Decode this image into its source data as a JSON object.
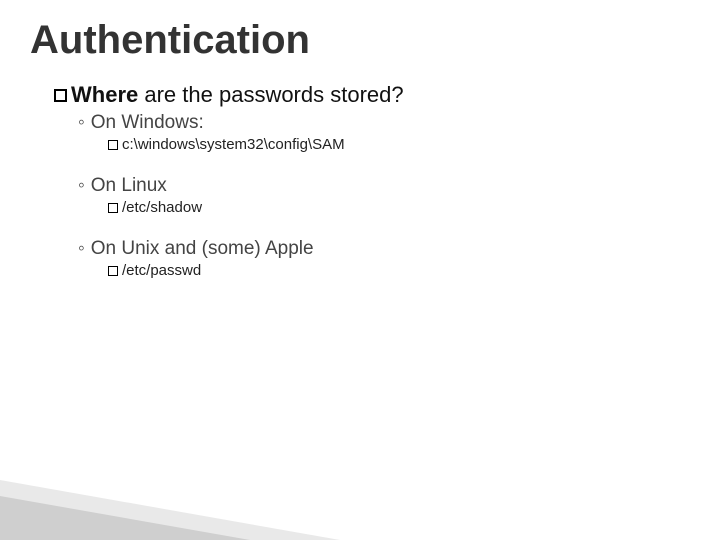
{
  "title": "Authentication",
  "question": {
    "lead": "Where",
    "rest": " are the passwords stored?"
  },
  "items": [
    {
      "label": "On Windows:",
      "path": "c:\\windows\\system32\\config\\SAM"
    },
    {
      "label": "On Linux",
      "path": "/etc/shadow"
    },
    {
      "label": "On Unix and (some) Apple",
      "path": "/etc/passwd"
    }
  ]
}
